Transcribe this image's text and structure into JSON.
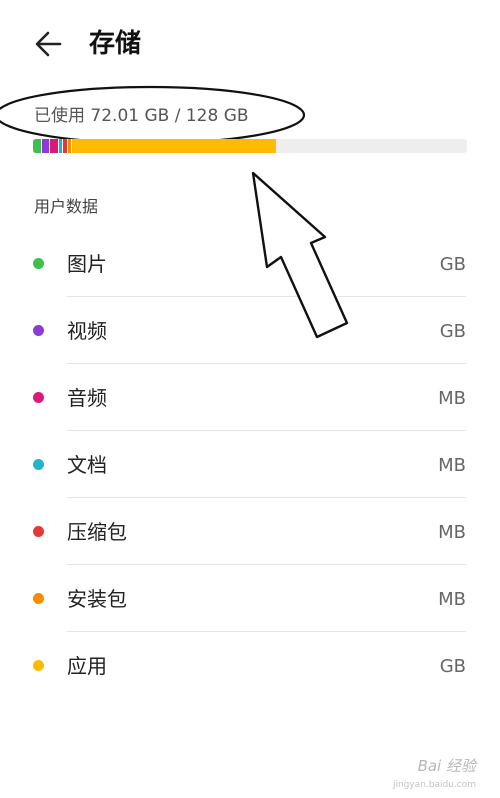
{
  "header": {
    "title": "存储",
    "back_icon": "arrow-left-icon"
  },
  "usage": {
    "label": "已使用 72.01 GB / 128 GB"
  },
  "storage_bar": {
    "track_color": "#eeeeee",
    "segments": [
      {
        "name": "图片",
        "fraction": 0.02,
        "color": "#3dbf4b"
      },
      {
        "name": "视频",
        "fraction": 0.02,
        "color": "#8e3ad6"
      },
      {
        "name": "音频",
        "fraction": 0.02,
        "color": "#d81b78"
      },
      {
        "name": "文档",
        "fraction": 0.01,
        "color": "#1fb6c9"
      },
      {
        "name": "压缩包",
        "fraction": 0.01,
        "color": "#e53935"
      },
      {
        "name": "安装包",
        "fraction": 0.01,
        "color": "#fb8c00"
      },
      {
        "name": "应用",
        "fraction": 0.47,
        "color": "#ffbb00"
      }
    ]
  },
  "section": {
    "title": "用户数据"
  },
  "items": [
    {
      "label": "图片",
      "size": "GB",
      "color": "#3dbf4b"
    },
    {
      "label": "视频",
      "size": "GB",
      "color": "#8e3ad6"
    },
    {
      "label": "音频",
      "size": "MB",
      "color": "#d81b78"
    },
    {
      "label": "文档",
      "size": "MB",
      "color": "#1fb6c9"
    },
    {
      "label": "压缩包",
      "size": "MB",
      "color": "#e53935"
    },
    {
      "label": "安装包",
      "size": "MB",
      "color": "#fb8c00"
    },
    {
      "label": "应用",
      "size": "GB",
      "color": "#ffbb00"
    }
  ],
  "watermark": {
    "text": "Bai 经验",
    "sub": "jingyan.baidu.com"
  }
}
